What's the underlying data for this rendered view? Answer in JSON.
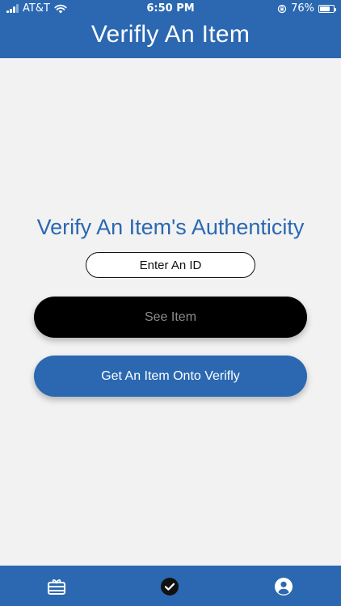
{
  "status_bar": {
    "carrier": "AT&T",
    "time": "6:50 PM",
    "battery_percent": "76%",
    "battery_level": 0.76,
    "icons": [
      "signal-icon",
      "wifi-icon",
      "orientation-lock-icon",
      "battery-icon"
    ]
  },
  "header": {
    "title": "Verifly An Item"
  },
  "main": {
    "heading": "Verify An Item's Authenticity",
    "id_input": {
      "placeholder": "Enter An ID",
      "value": ""
    },
    "see_item_button": "See Item",
    "get_item_button": "Get An Item Onto Verifly"
  },
  "tabbar": {
    "tabs": [
      {
        "icon": "gift-card-icon",
        "active": false
      },
      {
        "icon": "check-circle-icon",
        "active": true
      },
      {
        "icon": "account-circle-icon",
        "active": false
      }
    ]
  },
  "colors": {
    "brand": "#2b68b1",
    "background": "#f2f2f2",
    "see_item_bg": "#000000",
    "see_item_text": "#8c8c8c",
    "active_tab_icon": "#111111",
    "tab_icon": "#ffffff"
  }
}
